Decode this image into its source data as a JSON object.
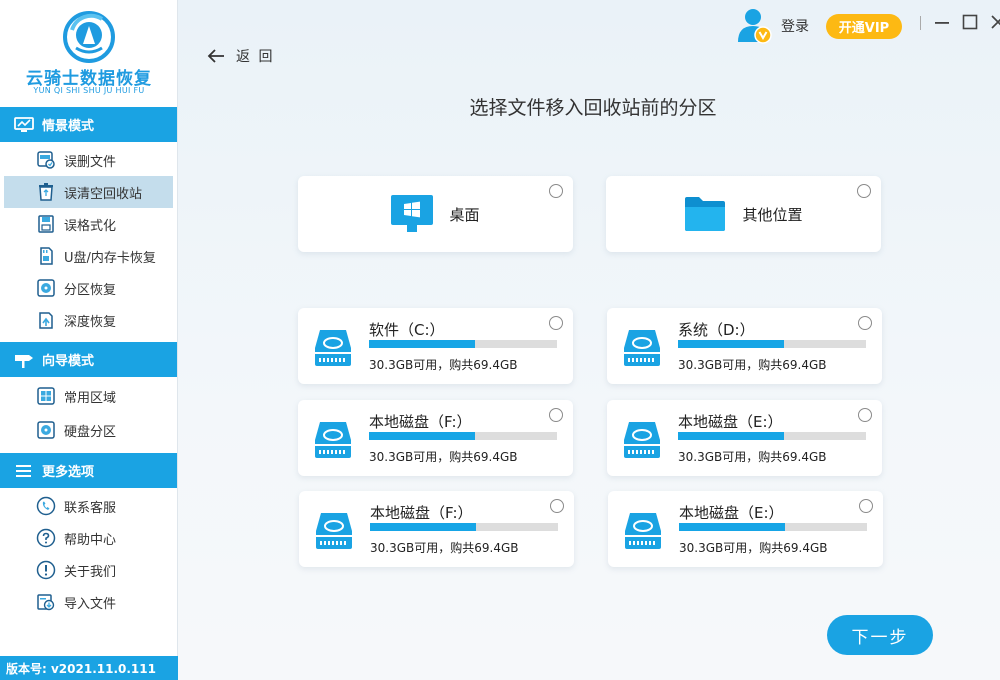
{
  "app": {
    "name": "云骑士数据恢复",
    "name_pinyin": "YUN QI SHI SHU JU HUI FU",
    "version": "版本号:  v2021.11.0.111"
  },
  "colors": {
    "accent": "#1aa3e3",
    "vip": "#fdb913",
    "active_item": "#c4ddec",
    "bar_fill": "#16a5e6",
    "bar_track": "#dddddd"
  },
  "sidebar": {
    "sections": [
      {
        "title": "情景模式",
        "icon": "monitor-icon",
        "items": [
          {
            "label": "误删文件",
            "icon": "file-recover-icon",
            "active": false
          },
          {
            "label": "误清空回收站",
            "icon": "recycle-bin-icon",
            "active": true
          },
          {
            "label": "误格式化",
            "icon": "format-disk-icon",
            "active": false
          },
          {
            "label": "U盘/内存卡恢复",
            "icon": "memory-card-icon",
            "active": false
          },
          {
            "label": "分区恢复",
            "icon": "partition-icon",
            "active": false
          },
          {
            "label": "深度恢复",
            "icon": "deep-recover-icon",
            "active": false
          }
        ]
      },
      {
        "title": "向导模式",
        "icon": "signpost-icon",
        "items": [
          {
            "label": "常用区域",
            "icon": "windows-icon",
            "active": false
          },
          {
            "label": "硬盘分区",
            "icon": "hard-disk-icon",
            "active": false
          }
        ]
      },
      {
        "title": "更多选项",
        "icon": "menu-icon",
        "items": [
          {
            "label": "联系客服",
            "icon": "phone-icon",
            "active": false
          },
          {
            "label": "帮助中心",
            "icon": "question-icon",
            "active": false
          },
          {
            "label": "关于我们",
            "icon": "info-icon",
            "active": false
          },
          {
            "label": "导入文件",
            "icon": "import-icon",
            "active": false
          }
        ]
      }
    ]
  },
  "header": {
    "login": "登录",
    "vip_button": "开通VIP",
    "back": "返 回"
  },
  "main": {
    "title": "选择文件移入回收站前的分区",
    "locations": [
      {
        "label": "桌面",
        "icon": "desktop-windows-icon"
      },
      {
        "label": "其他位置",
        "icon": "folder-icon"
      }
    ],
    "drives": [
      {
        "name": "软件（C:）",
        "info": "30.3GB可用，购共69.4GB",
        "used_fraction": 0.564
      },
      {
        "name": "系统（D:）",
        "info": "30.3GB可用，购共69.4GB",
        "used_fraction": 0.564
      },
      {
        "name": "本地磁盘（F:）",
        "info": "30.3GB可用，购共69.4GB",
        "used_fraction": 0.564
      },
      {
        "name": "本地磁盘（E:）",
        "info": "30.3GB可用，购共69.4GB",
        "used_fraction": 0.564
      },
      {
        "name": "本地磁盘（F:）",
        "info": "30.3GB可用，购共69.4GB",
        "used_fraction": 0.564
      },
      {
        "name": "本地磁盘（E:）",
        "info": "30.3GB可用，购共69.4GB",
        "used_fraction": 0.564
      }
    ],
    "next_button": "下一步"
  }
}
